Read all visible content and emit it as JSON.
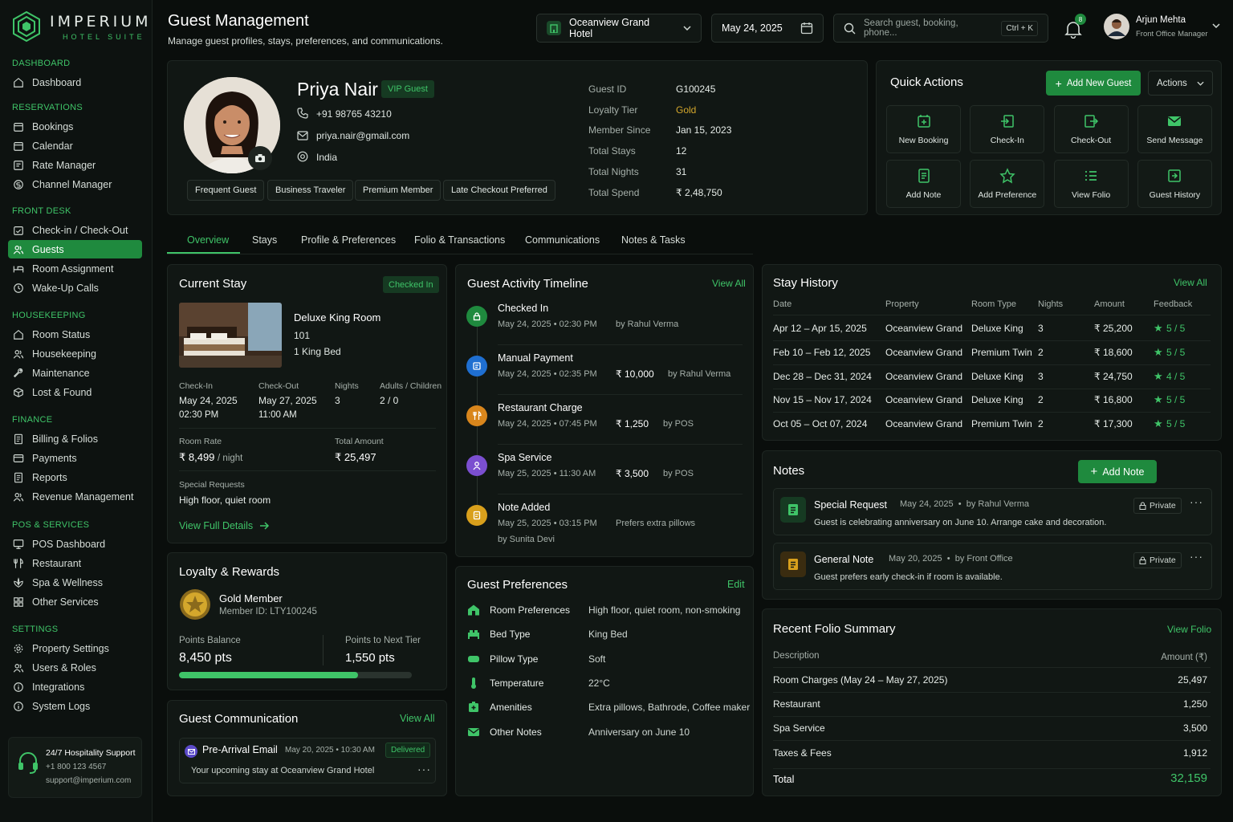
{
  "brand": {
    "name": "IMPERIUM",
    "sub": "HOTEL SUITE"
  },
  "sidebar": {
    "sections": [
      {
        "title": "DASHBOARD",
        "items": [
          {
            "label": "Dashboard",
            "icon": "home-icon"
          }
        ]
      },
      {
        "title": "RESERVATIONS",
        "items": [
          {
            "label": "Bookings",
            "icon": "calendar-icon"
          },
          {
            "label": "Calendar",
            "icon": "calendar-icon"
          },
          {
            "label": "Rate Manager",
            "icon": "tag-icon"
          },
          {
            "label": "Channel Manager",
            "icon": "dollar-icon"
          }
        ]
      },
      {
        "title": "FRONT DESK",
        "items": [
          {
            "label": "Check-in / Check-Out",
            "icon": "calendar-check-icon"
          },
          {
            "label": "Guests",
            "icon": "users-icon"
          },
          {
            "label": "Room Assignment",
            "icon": "bed-icon"
          },
          {
            "label": "Wake-Up Calls",
            "icon": "clock-icon"
          }
        ]
      },
      {
        "title": "HOUSEKEEPING",
        "items": [
          {
            "label": "Room Status",
            "icon": "home-icon"
          },
          {
            "label": "Housekeeping",
            "icon": "users-icon"
          },
          {
            "label": "Maintenance",
            "icon": "wrench-icon"
          },
          {
            "label": "Lost & Found",
            "icon": "box-icon"
          }
        ]
      },
      {
        "title": "FINANCE",
        "items": [
          {
            "label": "Billing & Folios",
            "icon": "document-icon"
          },
          {
            "label": "Payments",
            "icon": "card-icon"
          },
          {
            "label": "Reports",
            "icon": "document-icon"
          },
          {
            "label": "Revenue Management",
            "icon": "users-icon"
          }
        ]
      },
      {
        "title": "POS & SERVICES",
        "items": [
          {
            "label": "POS Dashboard",
            "icon": "monitor-icon"
          },
          {
            "label": "Restaurant",
            "icon": "fork-icon"
          },
          {
            "label": "Spa & Wellness",
            "icon": "spa-icon"
          },
          {
            "label": "Other Services",
            "icon": "grid-icon"
          }
        ]
      },
      {
        "title": "SETTINGS",
        "items": [
          {
            "label": "Property Settings",
            "icon": "gear-icon"
          },
          {
            "label": "Users & Roles",
            "icon": "users-icon"
          },
          {
            "label": "Integrations",
            "icon": "info-icon"
          },
          {
            "label": "System Logs",
            "icon": "info-icon"
          }
        ]
      }
    ],
    "support": {
      "title": "24/7 Hospitality Support",
      "phone": "+1 800 123 4567",
      "email": "support@imperium.com"
    }
  },
  "header": {
    "title": "Guest Management",
    "subtitle": "Manage guest profiles, stays, preferences, and communications.",
    "hotel": "Oceanview Grand Hotel",
    "date": "May 24, 2025",
    "search_placeholder": "Search guest, booking, phone...",
    "shortcut": "Ctrl + K",
    "notif_count": "8",
    "user_name": "Arjun Mehta",
    "user_role": "Front Office Manager"
  },
  "guest": {
    "name": "Priya Nair",
    "badge": "VIP Guest",
    "phone": "+91 98765 43210",
    "email": "priya.nair@gmail.com",
    "country": "India",
    "tags": [
      "Frequent Guest",
      "Business Traveler",
      "Premium Member",
      "Late Checkout Preferred"
    ],
    "info": [
      {
        "label": "Guest ID",
        "value": "G100245"
      },
      {
        "label": "Loyalty Tier",
        "value": "Gold"
      },
      {
        "label": "Member Since",
        "value": "Jan 15, 2023"
      },
      {
        "label": "Total Stays",
        "value": "12"
      },
      {
        "label": "Total Nights",
        "value": "31"
      },
      {
        "label": "Total Spend",
        "value": "₹ 2,48,750"
      }
    ]
  },
  "quick_actions": {
    "title": "Quick Actions",
    "add_label": "Add New Guest",
    "actions_label": "Actions",
    "items": [
      {
        "label": "New Booking",
        "icon": "calendar-plus-icon"
      },
      {
        "label": "Check-In",
        "icon": "check-in-icon"
      },
      {
        "label": "Check-Out",
        "icon": "check-out-icon"
      },
      {
        "label": "Send Message",
        "icon": "mail-icon"
      },
      {
        "label": "Add Note",
        "icon": "note-icon"
      },
      {
        "label": "Add Preference",
        "icon": "star-icon"
      },
      {
        "label": "View Folio",
        "icon": "list-icon"
      },
      {
        "label": "Guest History",
        "icon": "history-icon"
      }
    ]
  },
  "tabs": [
    "Overview",
    "Stays",
    "Profile & Preferences",
    "Folio & Transactions",
    "Communications",
    "Notes & Tasks"
  ],
  "current_stay": {
    "title": "Current Stay",
    "status": "Checked In",
    "room": "Deluxe King Room",
    "room_no": "101",
    "bed": "1 King Bed",
    "checkin_label": "Check-In",
    "checkin_date": "May 24, 2025",
    "checkin_time": "02:30 PM",
    "checkout_label": "Check-Out",
    "checkout_date": "May 27, 2025",
    "checkout_time": "11:00 AM",
    "nights_label": "Nights",
    "nights": "3",
    "guests_label": "Adults / Children",
    "guests": "2 / 0",
    "rate_label": "Room Rate",
    "rate": "₹ 8,499",
    "rate_unit": "/ night",
    "total_label": "Total Amount",
    "total": "₹ 25,497",
    "req_label": "Special Requests",
    "req": "High floor, quiet room",
    "link": "View Full Details"
  },
  "loyalty": {
    "title": "Loyalty & Rewards",
    "tier": "Gold Member",
    "member_id": "Member ID: LTY100245",
    "balance_label": "Points Balance",
    "balance": "8,450 pts",
    "next_label": "Points to Next Tier",
    "next": "1,550 pts",
    "progress": 0.77
  },
  "communication": {
    "title": "Guest Communication",
    "view_all": "View All",
    "item_title": "Pre-Arrival Email",
    "item_time": "May 20, 2025 • 10:30 AM",
    "item_status": "Delivered",
    "item_text": "Your upcoming stay at Oceanview Grand Hotel"
  },
  "timeline": {
    "title": "Guest Activity Timeline",
    "view_all": "View All",
    "items": [
      {
        "title": "Checked In",
        "time": "May 24, 2025 • 02:30 PM",
        "amount": "",
        "by": "by Rahul Verma",
        "color": "#1f8a3e",
        "icon": "lock-icon"
      },
      {
        "title": "Manual Payment",
        "time": "May 24, 2025 • 02:35 PM",
        "amount": "₹ 10,000",
        "by": "by Rahul Verma",
        "color": "#1f6fd1",
        "icon": "payment-icon"
      },
      {
        "title": "Restaurant Charge",
        "time": "May 24, 2025 • 07:45 PM",
        "amount": "₹ 1,250",
        "by": "by POS",
        "color": "#d9861c",
        "icon": "fork-icon"
      },
      {
        "title": "Spa Service",
        "time": "May 25, 2025 • 11:30 AM",
        "amount": "₹ 3,500",
        "by": "by POS",
        "color": "#7b4fd0",
        "icon": "person-icon"
      },
      {
        "title": "Note Added",
        "time": "May 25, 2025 • 03:15 PM",
        "amount": "",
        "by": "Prefers extra pillows",
        "by2": "by Sunita Devi",
        "color": "#d9a01c",
        "icon": "note-icon"
      }
    ]
  },
  "preferences": {
    "title": "Guest Preferences",
    "edit": "Edit",
    "items": [
      {
        "label": "Room Preferences",
        "value": "High floor, quiet room, non-smoking",
        "icon": "home-icon"
      },
      {
        "label": "Bed Type",
        "value": "King Bed",
        "icon": "bed-icon"
      },
      {
        "label": "Pillow Type",
        "value": "Soft",
        "icon": "pillow-icon"
      },
      {
        "label": "Temperature",
        "value": "22°C",
        "icon": "thermometer-icon"
      },
      {
        "label": "Amenities",
        "value": "Extra pillows, Bathrode, Coffee maker",
        "icon": "amenities-icon"
      },
      {
        "label": "Other Notes",
        "value": "Anniversary on June 10",
        "icon": "mail-icon"
      }
    ]
  },
  "stay_history": {
    "title": "Stay History",
    "view_all": "View All",
    "columns": [
      "Date",
      "Property",
      "Room Type",
      "Nights",
      "Amount",
      "Feedback"
    ],
    "rows": [
      {
        "date": "Apr 12 – Apr 15, 2025",
        "property": "Oceanview Grand",
        "room": "Deluxe King",
        "nights": "3",
        "amount": "₹ 25,200",
        "feedback": "5 / 5"
      },
      {
        "date": "Feb 10 – Feb 12, 2025",
        "property": "Oceanview Grand",
        "room": "Premium Twin",
        "nights": "2",
        "amount": "₹ 18,600",
        "feedback": "5 / 5"
      },
      {
        "date": "Dec 28 – Dec 31, 2024",
        "property": "Oceanview Grand",
        "room": "Deluxe King",
        "nights": "3",
        "amount": "₹ 24,750",
        "feedback": "4 / 5"
      },
      {
        "date": "Nov 15 – Nov 17, 2024",
        "property": "Oceanview Grand",
        "room": "Deluxe King",
        "nights": "2",
        "amount": "₹ 16,800",
        "feedback": "5 / 5"
      },
      {
        "date": "Oct 05 – Oct 07, 2024",
        "property": "Oceanview Grand",
        "room": "Premium Twin",
        "nights": "2",
        "amount": "₹ 17,300",
        "feedback": "5 / 5"
      }
    ]
  },
  "notes": {
    "title": "Notes",
    "add": "Add Note",
    "items": [
      {
        "title": "Special Request",
        "meta": "May 24, 2025  •  by Rahul Verma",
        "privacy": "Private",
        "text": "Guest is celebrating anniversary on June 10. Arrange cake and decoration.",
        "color": "#3fc468"
      },
      {
        "title": "General Note",
        "meta": "May 20, 2025  •  by Front Office",
        "privacy": "Private",
        "text": "Guest prefers early check-in if room is available.",
        "color": "#d9a01c"
      }
    ]
  },
  "folio": {
    "title": "Recent Folio Summary",
    "view": "View Folio",
    "col_desc": "Description",
    "col_amount": "Amount (₹)",
    "rows": [
      {
        "desc": "Room Charges (May 24 – May 27, 2025)",
        "amount": "25,497"
      },
      {
        "desc": "Restaurant",
        "amount": "1,250"
      },
      {
        "desc": "Spa Service",
        "amount": "3,500"
      },
      {
        "desc": "Taxes & Fees",
        "amount": "1,912"
      }
    ],
    "total_label": "Total",
    "total": "32,159"
  }
}
